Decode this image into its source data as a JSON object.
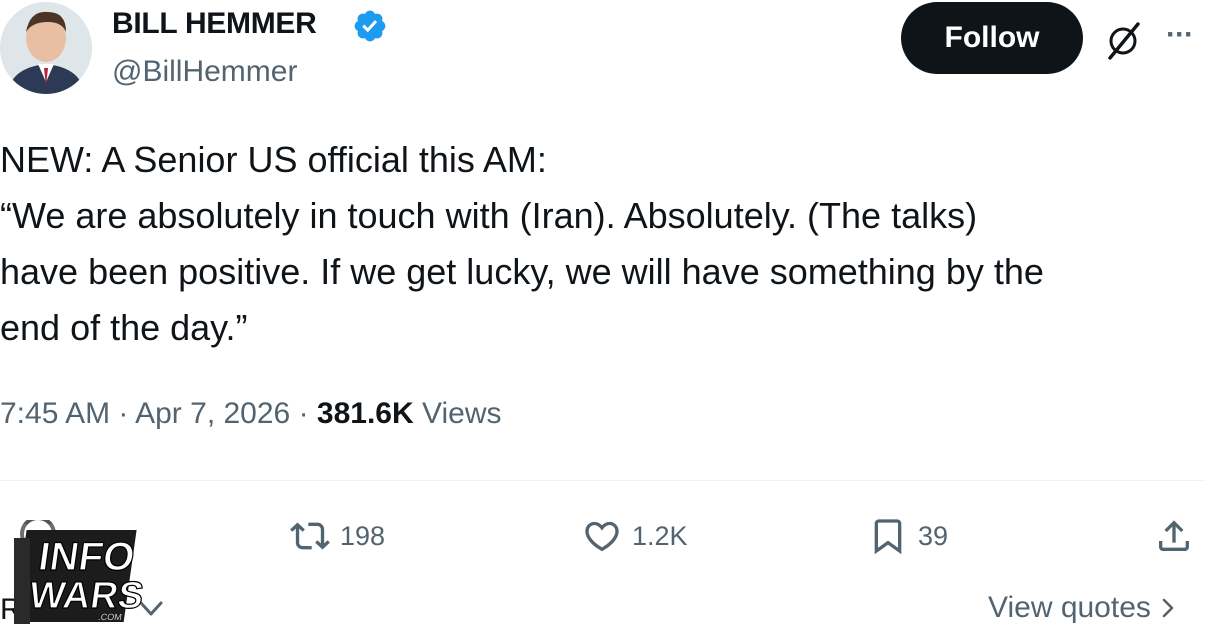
{
  "author": {
    "display_name": "BILL HEMMER",
    "handle": "@BillHemmer",
    "verified_color": "#1d9bf0",
    "avatar": "avatar"
  },
  "header": {
    "follow_label": "Follow",
    "grok_icon": "grok-icon",
    "more_icon": "more-icon",
    "more_glyph": "···"
  },
  "tweet": {
    "lines": [
      "NEW: A Senior US official this AM:",
      "“We are absolutely in touch with (Iran). Absolutely. (The talks)",
      "have been positive. If we get lucky, we will have something by the",
      "end of the day.”"
    ]
  },
  "meta": {
    "time": "7:45 AM",
    "separator": "·",
    "date": "Apr 7, 2026",
    "views_count": "381.6K",
    "views_label": "Views"
  },
  "actions": {
    "retweets": "198",
    "likes": "1.2K",
    "bookmarks": "39"
  },
  "footer": {
    "reply_fragment": "R",
    "view_quotes_label": "View quotes"
  },
  "watermark": {
    "logo_text": "INFOWARS.COM"
  },
  "colors": {
    "text_primary": "#0f1419",
    "text_secondary": "#536471",
    "follow_bg": "#0f1419",
    "divider": "#eff3f4"
  }
}
